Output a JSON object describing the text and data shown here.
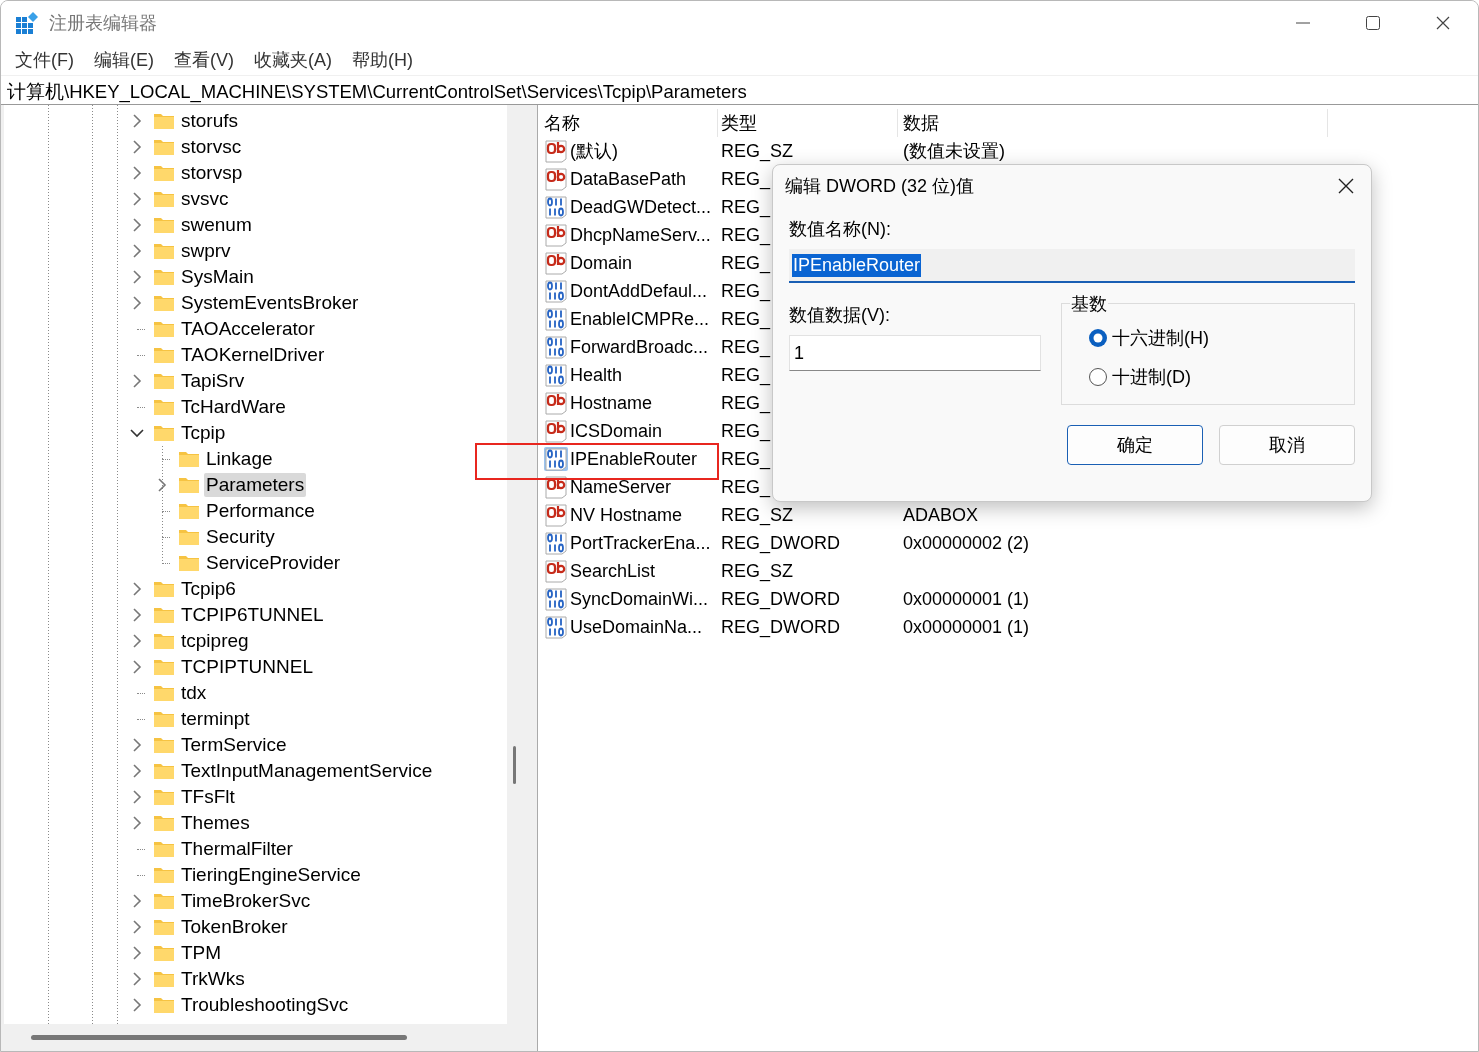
{
  "window": {
    "title": "注册表编辑器"
  },
  "menu": [
    "文件(F)",
    "编辑(E)",
    "查看(V)",
    "收藏夹(A)",
    "帮助(H)"
  ],
  "address": "计算机\\HKEY_LOCAL_MACHINE\\SYSTEM\\CurrentControlSet\\Services\\Tcpip\\Parameters",
  "tree": [
    {
      "name": "storufs",
      "has_children": true,
      "selected": false
    },
    {
      "name": "storvsc",
      "has_children": true,
      "selected": false
    },
    {
      "name": "storvsp",
      "has_children": true,
      "selected": false
    },
    {
      "name": "svsvc",
      "has_children": true,
      "selected": false
    },
    {
      "name": "swenum",
      "has_children": true,
      "selected": false
    },
    {
      "name": "swprv",
      "has_children": true,
      "selected": false
    },
    {
      "name": "SysMain",
      "has_children": true,
      "selected": false
    },
    {
      "name": "SystemEventsBroker",
      "has_children": true,
      "selected": false
    },
    {
      "name": "TAOAccelerator",
      "has_children": false,
      "selected": false
    },
    {
      "name": "TAOKernelDriver",
      "has_children": false,
      "selected": false
    },
    {
      "name": "TapiSrv",
      "has_children": true,
      "selected": false
    },
    {
      "name": "TcHardWare",
      "has_children": false,
      "selected": false
    },
    {
      "name": "Tcpip",
      "has_children": true,
      "expanded": true,
      "selected": false,
      "children": [
        {
          "name": "Linkage",
          "has_children": false,
          "selected": false
        },
        {
          "name": "Parameters",
          "has_children": true,
          "selected": true
        },
        {
          "name": "Performance",
          "has_children": false,
          "selected": false
        },
        {
          "name": "Security",
          "has_children": false,
          "selected": false
        },
        {
          "name": "ServiceProvider",
          "has_children": false,
          "selected": false
        }
      ]
    },
    {
      "name": "Tcpip6",
      "has_children": true,
      "selected": false
    },
    {
      "name": "TCPIP6TUNNEL",
      "has_children": true,
      "selected": false
    },
    {
      "name": "tcpipreg",
      "has_children": true,
      "selected": false
    },
    {
      "name": "TCPIPTUNNEL",
      "has_children": true,
      "selected": false
    },
    {
      "name": "tdx",
      "has_children": false,
      "selected": false
    },
    {
      "name": "terminpt",
      "has_children": false,
      "selected": false
    },
    {
      "name": "TermService",
      "has_children": true,
      "selected": false
    },
    {
      "name": "TextInputManagementService",
      "has_children": true,
      "selected": false
    },
    {
      "name": "TFsFlt",
      "has_children": true,
      "selected": false
    },
    {
      "name": "Themes",
      "has_children": true,
      "selected": false
    },
    {
      "name": "ThermalFilter",
      "has_children": false,
      "selected": false
    },
    {
      "name": "TieringEngineService",
      "has_children": false,
      "selected": false
    },
    {
      "name": "TimeBrokerSvc",
      "has_children": true,
      "selected": false
    },
    {
      "name": "TokenBroker",
      "has_children": true,
      "selected": false
    },
    {
      "name": "TPM",
      "has_children": true,
      "selected": false
    },
    {
      "name": "TrkWks",
      "has_children": true,
      "selected": false
    },
    {
      "name": "TroubleshootingSvc",
      "has_children": true,
      "selected": false
    }
  ],
  "values": {
    "columns": [
      "名称",
      "类型",
      "数据"
    ],
    "rows": [
      {
        "kind": "string",
        "name": "(默认)",
        "type": "REG_SZ",
        "data": "(数值未设置)",
        "selected": false
      },
      {
        "kind": "string",
        "name": "DataBasePath",
        "type": "REG_",
        "selected": false
      },
      {
        "kind": "binary",
        "name": "DeadGWDetect...",
        "type": "REG_",
        "selected": false
      },
      {
        "kind": "string",
        "name": "DhcpNameServ...",
        "type": "REG_",
        "selected": false
      },
      {
        "kind": "string",
        "name": "Domain",
        "type": "REG_",
        "selected": false
      },
      {
        "kind": "binary",
        "name": "DontAddDefaul...",
        "type": "REG_",
        "selected": false
      },
      {
        "kind": "binary",
        "name": "EnableICMPRe...",
        "type": "REG_",
        "selected": false
      },
      {
        "kind": "binary",
        "name": "ForwardBroadc...",
        "type": "REG_",
        "selected": false
      },
      {
        "kind": "binary",
        "name": "Health",
        "type": "REG_",
        "selected": false
      },
      {
        "kind": "string",
        "name": "Hostname",
        "type": "REG_",
        "selected": false
      },
      {
        "kind": "string",
        "name": "ICSDomain",
        "type": "REG_",
        "selected": false
      },
      {
        "kind": "binary",
        "name": "IPEnableRouter",
        "type": "REG_",
        "selected": true
      },
      {
        "kind": "string",
        "name": "NameServer",
        "type": "REG_",
        "selected": false
      },
      {
        "kind": "string",
        "name": "NV Hostname",
        "type": "REG_SZ",
        "data": "ADABOX",
        "selected": false
      },
      {
        "kind": "binary",
        "name": "PortTrackerEna...",
        "type": "REG_DWORD",
        "data": "0x00000002 (2)",
        "selected": false
      },
      {
        "kind": "string",
        "name": "SearchList",
        "type": "REG_SZ",
        "selected": false
      },
      {
        "kind": "binary",
        "name": "SyncDomainWi...",
        "type": "REG_DWORD",
        "data": "0x00000001 (1)",
        "selected": false
      },
      {
        "kind": "binary",
        "name": "UseDomainNa...",
        "type": "REG_DWORD",
        "data": "0x00000001 (1)",
        "selected": false
      }
    ]
  },
  "dialog": {
    "title": "编辑 DWORD (32 位)值",
    "name_label": "数值名称(N):",
    "name_value": "IPEnableRouter",
    "data_label": "数值数据(V):",
    "data_value": "1",
    "base": {
      "label": "基数",
      "options": [
        {
          "label": "十六进制(H)",
          "selected": true
        },
        {
          "label": "十进制(D)",
          "selected": false
        }
      ]
    },
    "buttons": [
      {
        "label": "确定",
        "default": true
      },
      {
        "label": "取消",
        "default": false
      }
    ]
  }
}
